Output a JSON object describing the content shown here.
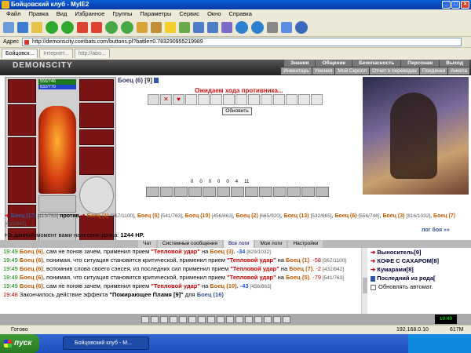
{
  "window": {
    "title": "Бойцовский клуб - MyIE2"
  },
  "menu": [
    "Файл",
    "Правка",
    "Вид",
    "Избранное",
    "Группы",
    "Параметры",
    "Сервис",
    "Окно",
    "Справка"
  ],
  "address": {
    "label": "Адрес",
    "url": "http://demonscity.combats.com/buttons.pl?battle=0.783290955219989"
  },
  "tabs": [
    "Бойцовск...",
    "Інтернет...",
    "http://abo..."
  ],
  "site": {
    "logo": "DEMONSCITY",
    "toplinks": [
      "Знания",
      "Общение",
      "Безопасность",
      "Персонаж",
      "Выход"
    ],
    "sublinks": [
      "Инвентарь",
      "Умения",
      "Мой Скролл",
      "Отчет о переводах",
      "Поединки",
      "Анкета"
    ]
  },
  "player": {
    "hp": "556/746",
    "mp": "632/770"
  },
  "fight": {
    "opponent_name": "Боец (6)",
    "opponent_level": "[9]",
    "waiting_text": "Ожидаем хода противника...",
    "refresh_label": "Обновить",
    "counts": [
      "0",
      "0",
      "0",
      "0",
      "0",
      "4",
      "11"
    ]
  },
  "teams": {
    "left": {
      "name": "Боец (17)",
      "hp": "[113/763]"
    },
    "vs": "против",
    "right": [
      {
        "name": "Боец (1)",
        "hp": "[367/1100]"
      },
      {
        "name": "Боец (5)",
        "hp": "[541/763]"
      },
      {
        "name": "Боец (10)",
        "hp": "[456/863]"
      },
      {
        "name": "Боец (2)",
        "hp": "[665/920]"
      },
      {
        "name": "Боец (13)",
        "hp": "[532/865]"
      },
      {
        "name": "Боец (6)",
        "hp": "[556/746]"
      },
      {
        "name": "Боец (3)",
        "hp": "[816/1032]"
      },
      {
        "name": "Боец (7)",
        "hp": "[432/842]"
      }
    ]
  },
  "damage": {
    "label": "На данный момент вами нанесено урона:",
    "value": "1244 HP."
  },
  "log_link": "лог боя »»",
  "chat_tabs": [
    "Чат",
    "Системные сообщения",
    "Все логи",
    "Мои логи",
    "Настройки"
  ],
  "chat": [
    {
      "time": "19:49",
      "who": "Боец (6)",
      "text": ", сам не поняв зачем, применил прием ",
      "skill": "\"Тепловой удар\"",
      "tail": " на ",
      "target": "Боец (3)",
      "dmg": ". -34",
      "hp": " [829/1032]"
    },
    {
      "time": "19:49",
      "who": "Боец (6)",
      "text": ", понимая, что ситуация становится критической, применил прием ",
      "skill": "\"Тепловой удар\"",
      "tail": " на ",
      "target": "Боец (1)",
      "dmg": ". -58",
      "hp": " [367/1100]"
    },
    {
      "time": "19:49",
      "who": "Боец (6)",
      "text": ", вспомнив слова своего сэнсея, из последних сил применил прием ",
      "skill": "\"Тепловой удар\"",
      "tail": " на ",
      "target": "Боец (7)",
      "dmg": ". -2",
      "hp": " [432/842]"
    },
    {
      "time": "19:49",
      "who": "Боец (6)",
      "text": ", понимая, что ситуация становится критической, применил прием ",
      "skill": "\"Тепловой удар\"",
      "tail": " на ",
      "target": "Боец (5)",
      "dmg": ". -79",
      "hp": " [541/763]"
    },
    {
      "time": "19:49",
      "who": "Боец (6)",
      "text": ", сам не поняв зачем, применил прием ",
      "skill": "\"Тепловой удар\"",
      "tail": " на ",
      "target": "Боец (10)",
      "dmg": ". -43",
      "hp": " [456/863]"
    },
    {
      "time": "19:48",
      "who": "",
      "text": "Закончилось действие эффекта ",
      "skill": "\"Пожирающее Пламя [9]\"",
      "tail": " для ",
      "target": "Боец (16)",
      "dmg": "",
      "hp": ""
    }
  ],
  "users": [
    "Выноситель[9]",
    "КОФЕ С САХАРОМ[8]",
    "Кумарами[8]",
    "Последний из рода["
  ],
  "auto_refresh": "Обновлять автомат.",
  "clock": "19:49",
  "status": {
    "text": "Готово",
    "ip": "192.168.0.10",
    "mem": "617M"
  },
  "taskbar": {
    "start": "пуск",
    "task": "Бойцовский клуб - M..."
  }
}
